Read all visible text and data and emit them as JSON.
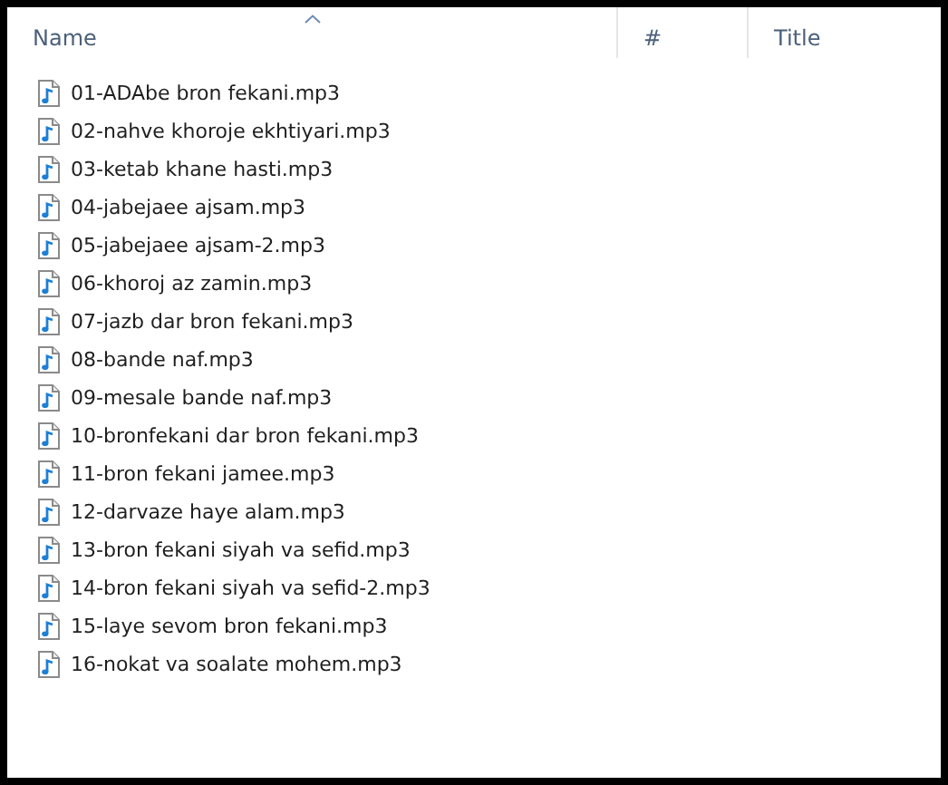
{
  "columns": [
    {
      "label": "Name",
      "sorted": true
    },
    {
      "label": "#",
      "sorted": false
    },
    {
      "label": "Title",
      "sorted": false
    }
  ],
  "files": [
    {
      "name": "01-ADAbe bron fekani.mp3"
    },
    {
      "name": "02-nahve khoroje ekhtiyari.mp3"
    },
    {
      "name": "03-ketab khane hasti.mp3"
    },
    {
      "name": "04-jabejaee ajsam.mp3"
    },
    {
      "name": "05-jabejaee ajsam-2.mp3"
    },
    {
      "name": "06-khoroj az zamin.mp3"
    },
    {
      "name": "07-jazb dar bron fekani.mp3"
    },
    {
      "name": "08-bande naf.mp3"
    },
    {
      "name": "09-mesale bande naf.mp3"
    },
    {
      "name": "10-bronfekani dar bron fekani.mp3"
    },
    {
      "name": "11-bron fekani jamee.mp3"
    },
    {
      "name": "12-darvaze haye alam.mp3"
    },
    {
      "name": "13-bron fekani siyah va sefid.mp3"
    },
    {
      "name": "14-bron fekani siyah va sefid-2.mp3"
    },
    {
      "name": "15-laye sevom bron fekani.mp3"
    },
    {
      "name": "16-nokat va soalate mohem.mp3"
    }
  ]
}
